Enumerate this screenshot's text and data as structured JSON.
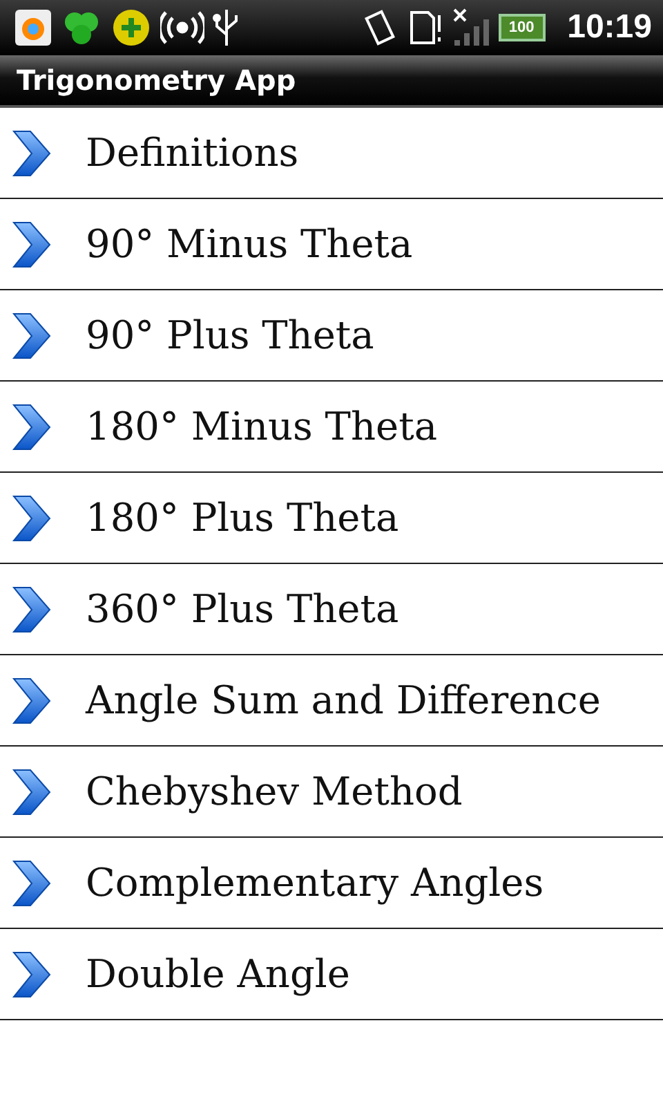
{
  "status_bar": {
    "battery": "100",
    "time": "10:19"
  },
  "title_bar": {
    "title": "Trigonometry App"
  },
  "menu": [
    {
      "label": "Definitions"
    },
    {
      "label": "90° Minus Theta"
    },
    {
      "label": "90° Plus Theta"
    },
    {
      "label": "180° Minus Theta"
    },
    {
      "label": "180° Plus Theta"
    },
    {
      "label": "360° Plus Theta"
    },
    {
      "label": "Angle Sum and Difference"
    },
    {
      "label": "Chebyshev Method"
    },
    {
      "label": "Complementary Angles"
    },
    {
      "label": "Double Angle"
    }
  ]
}
